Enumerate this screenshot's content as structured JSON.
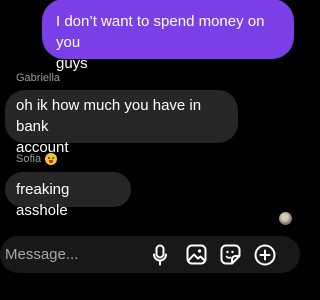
{
  "messages": {
    "outgoing": {
      "text": "I don’t want to spend money on you\nguys"
    },
    "gabriella": {
      "sender": "Gabriella",
      "text": "oh ik how much you have in bank\naccount"
    },
    "sofia": {
      "sender": "Sofia",
      "sender_emoji": "grinning-face-emoji",
      "text": "freaking asshole"
    }
  },
  "composer": {
    "placeholder": "Message...",
    "value": ""
  },
  "icons": {
    "mic": "microphone-icon",
    "gallery": "gallery-icon",
    "sticker": "sticker-icon",
    "more": "plus-circle-icon",
    "seen": "seen-avatar"
  },
  "colors": {
    "background": "#000000",
    "outgoing_bubble": "#7b3fe7",
    "incoming_bubble": "#262626",
    "composer_bg": "#181818",
    "sender_text": "#9a9a9a"
  }
}
